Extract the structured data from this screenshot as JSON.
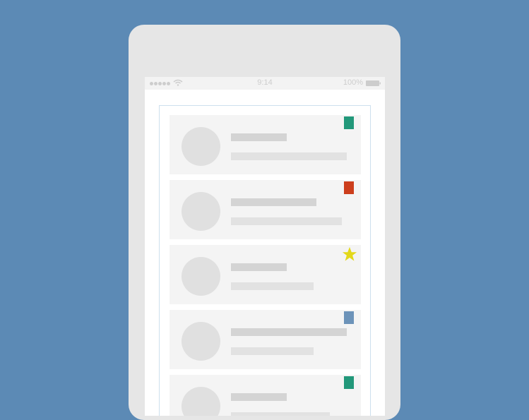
{
  "status_bar": {
    "time": "9:14",
    "battery_percent": "100%",
    "signal_icon": "signal-dots-icon",
    "wifi_icon": "wifi-icon",
    "battery_icon": "battery-icon"
  },
  "colors": {
    "background": "#5c8ab5",
    "tag_green": "#22987a",
    "tag_red": "#cc3e1c",
    "tag_blue": "#6c93b9",
    "star_yellow": "#e3d81a"
  },
  "list": {
    "items": [
      {
        "marker": "green-flag-icon"
      },
      {
        "marker": "red-flag-icon"
      },
      {
        "marker": "star-icon"
      },
      {
        "marker": "blue-flag-icon"
      },
      {
        "marker": "green-flag-icon"
      }
    ]
  }
}
